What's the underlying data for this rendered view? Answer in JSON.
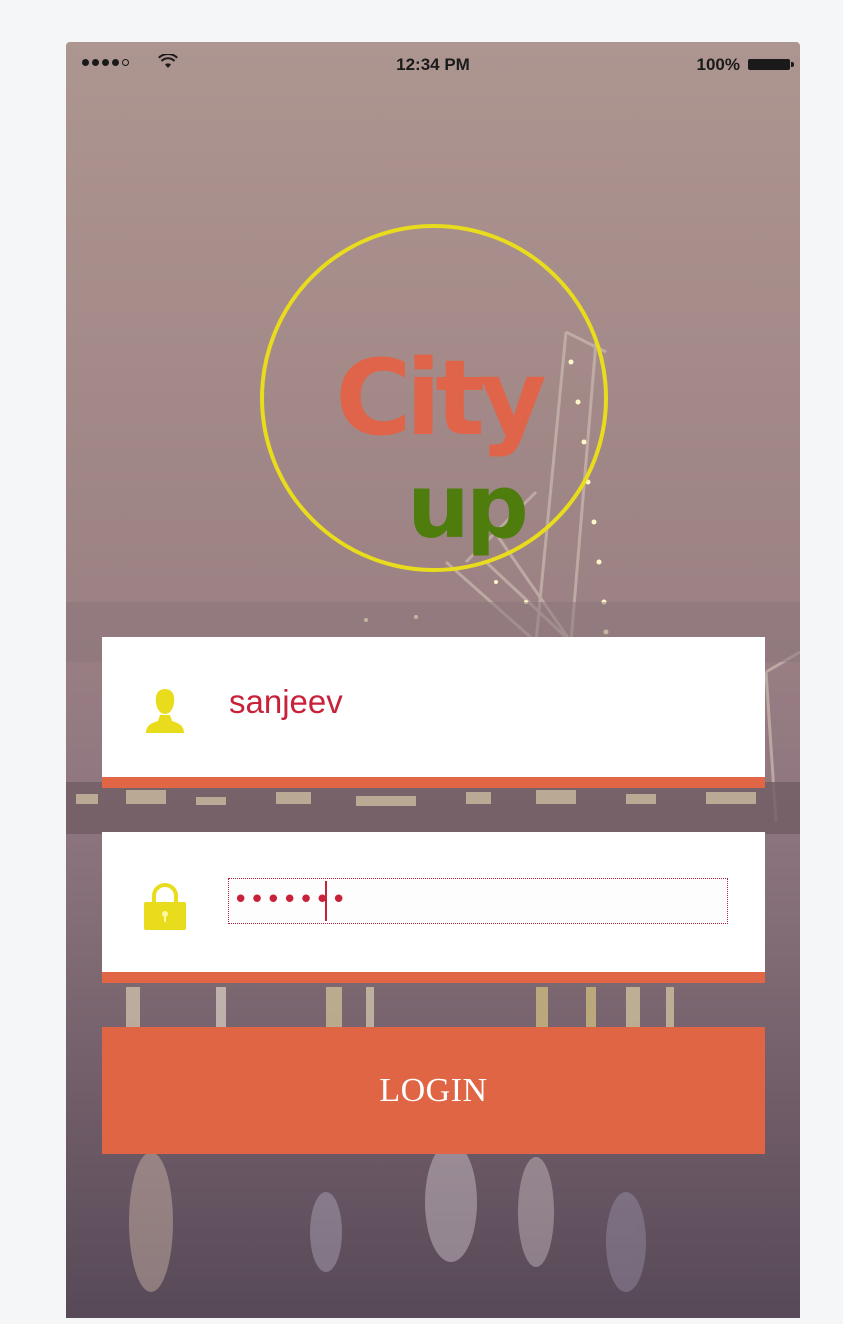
{
  "status_bar": {
    "time": "12:34 PM",
    "battery_percent": "100%",
    "signal_strength": 4,
    "signal_max": 5
  },
  "logo": {
    "line1": "City",
    "line2": "up",
    "ring_color": "#e8dc1c",
    "line1_color": "#e0644a",
    "line2_color": "#4f7d0d"
  },
  "username_field": {
    "value": "sanjeev",
    "icon": "user-icon"
  },
  "password_field": {
    "masked_value": "•••••••",
    "icon": "lock-icon"
  },
  "login_button": {
    "label": "LOGIN"
  },
  "colors": {
    "accent": "#e06646",
    "icon_yellow": "#e8dc1c",
    "text_red": "#c8223a"
  }
}
